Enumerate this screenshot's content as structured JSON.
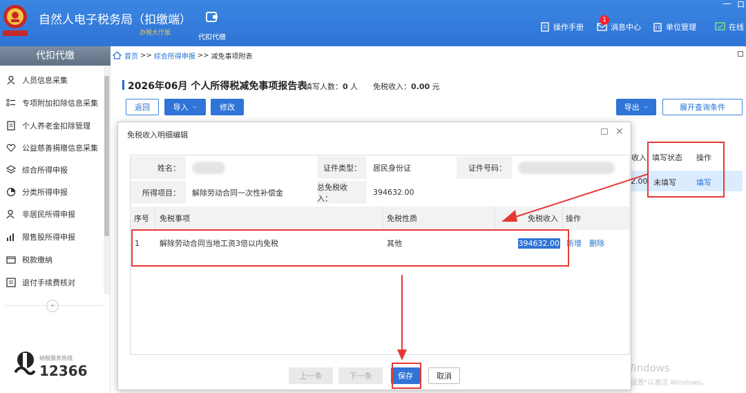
{
  "header": {
    "title": "自然人电子税务局（扣缴端）",
    "subtitle": "办税大厅版",
    "module_label": "代扣代缴",
    "right_items": [
      {
        "label": "操作手册",
        "icon": "book-icon"
      },
      {
        "label": "消息中心",
        "icon": "mail-icon",
        "badge": "1"
      },
      {
        "label": "单位管理",
        "icon": "building-icon"
      },
      {
        "label": "在线",
        "icon": "chat-icon"
      }
    ],
    "minimize": "—",
    "maximize": "口"
  },
  "sidebar": {
    "heading": "代扣代缴",
    "items": [
      {
        "label": "人员信息采集",
        "icon": "person-icon"
      },
      {
        "label": "专项附加扣除信息采集",
        "icon": "list-icon"
      },
      {
        "label": "个人养老金扣除管理",
        "icon": "document-icon"
      },
      {
        "label": "公益慈善捐赠信息采集",
        "icon": "heart-icon"
      },
      {
        "label": "综合所得申报",
        "icon": "layers-icon"
      },
      {
        "label": "分类所得申报",
        "icon": "pie-icon"
      },
      {
        "label": "非居民所得申报",
        "icon": "person-outline-icon"
      },
      {
        "label": "限售股所得申报",
        "icon": "bar-chart-icon"
      },
      {
        "label": "税款缴纳",
        "icon": "folder-icon"
      },
      {
        "label": "退付手续费核对",
        "icon": "checklist-icon"
      }
    ],
    "collapse": "«",
    "hotline_label": "纳税服务热线",
    "hotline_number": "12366"
  },
  "breadcrumb": {
    "home": "首页",
    "sep": ">>",
    "level1": "综合所得申报",
    "current": "减免事项附表"
  },
  "report": {
    "title": "2026年06月  个人所得税减免事项报告表",
    "count_label": "填写人数：",
    "count_value": "0",
    "count_unit": "人",
    "income_label": "免税收入：",
    "income_value": "0.00",
    "income_unit": "元",
    "buttons": {
      "back": "返回",
      "import": "导入",
      "modify": "修改",
      "export": "导出",
      "expand": "展开查询条件"
    }
  },
  "background_table": {
    "headers": [
      "收入",
      "填写状态",
      "操作"
    ],
    "row": {
      "income": "2.00",
      "status": "未填写",
      "action": "填写"
    }
  },
  "dialog": {
    "title": "免税收入明细编辑",
    "close": "✕",
    "name_label": "姓名：",
    "id_type_label": "证件类型：",
    "id_type_value": "居民身份证",
    "id_number_label": "证件号码：",
    "income_item_label": "所得项目：",
    "income_item_value": "解除劳动合同一次性补偿金",
    "total_label": "总免税收入：",
    "total_value": "394632.00",
    "grid_headers": {
      "seq": "序号",
      "item": "免税事项",
      "nature": "免税性质",
      "income": "免税收入",
      "ops": "操作"
    },
    "rows": [
      {
        "seq": "1",
        "item": "解除劳动合同当地工资3倍以内免税",
        "nature": "其他",
        "income": "394632.00",
        "add": "新增",
        "delete": "删除"
      }
    ],
    "footer": {
      "prev": "上一条",
      "next": "下一条",
      "save": "保存",
      "cancel": "取消"
    }
  },
  "watermark": {
    "line1": "激活 Windows",
    "line2": "转到\"电脑设置\"以激活 Windows。"
  },
  "colors": {
    "primary": "#2f74d6",
    "highlight": "#e53935",
    "selected_row": "#dcecff"
  }
}
